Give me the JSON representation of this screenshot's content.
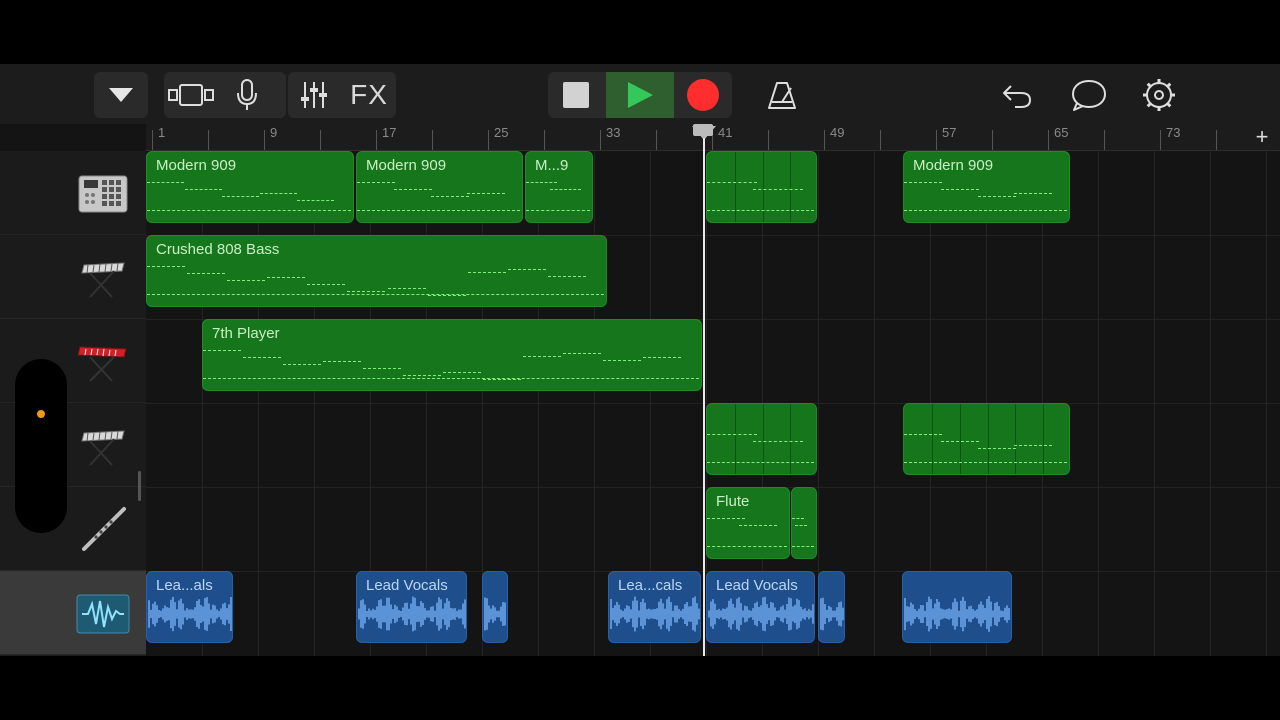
{
  "toolbar": {
    "fx_label": "FX",
    "icons": [
      "tracks-menu-icon",
      "view-toggle-icon",
      "microphone-icon",
      "mixer-icon",
      "stop-icon",
      "play-icon",
      "record-icon",
      "metronome-icon",
      "undo-icon",
      "loop-browser-icon",
      "settings-icon"
    ],
    "colors": {
      "play": "#34c759",
      "record": "#ff2d2d"
    }
  },
  "ruler": {
    "bars": [
      "1",
      "9",
      "17",
      "25",
      "33",
      "41",
      "49",
      "57",
      "65",
      "73"
    ],
    "add_label": "+"
  },
  "tracks": [
    {
      "instrument": "drum-machine-icon"
    },
    {
      "instrument": "keyboard-icon"
    },
    {
      "instrument": "red-synth-icon"
    },
    {
      "instrument": "keyboard-icon"
    },
    {
      "instrument": "flute-icon"
    },
    {
      "instrument": "audio-waveform-icon"
    }
  ],
  "regions": [
    {
      "track": 0,
      "name": "Modern 909",
      "color": "green"
    },
    {
      "track": 0,
      "name": "Modern 909",
      "color": "green"
    },
    {
      "track": 0,
      "name": "M...9",
      "color": "green"
    },
    {
      "track": 0,
      "name": "",
      "color": "green"
    },
    {
      "track": 0,
      "name": "Modern 909",
      "color": "green"
    },
    {
      "track": 1,
      "name": "Crushed 808 Bass",
      "color": "green"
    },
    {
      "track": 2,
      "name": "7th Player",
      "color": "green"
    },
    {
      "track": 3,
      "name": "",
      "color": "green"
    },
    {
      "track": 3,
      "name": "",
      "color": "green"
    },
    {
      "track": 4,
      "name": "Flute",
      "color": "green"
    },
    {
      "track": 4,
      "name": "",
      "color": "green"
    },
    {
      "track": 5,
      "name": "Lea...als",
      "color": "blue"
    },
    {
      "track": 5,
      "name": "Lead Vocals",
      "color": "blue"
    },
    {
      "track": 5,
      "name": "",
      "color": "blue"
    },
    {
      "track": 5,
      "name": "Lea...cals",
      "color": "blue"
    },
    {
      "track": 5,
      "name": "Lead Vocals",
      "color": "blue"
    },
    {
      "track": 5,
      "name": "",
      "color": "blue"
    },
    {
      "track": 5,
      "name": "",
      "color": "blue"
    }
  ]
}
